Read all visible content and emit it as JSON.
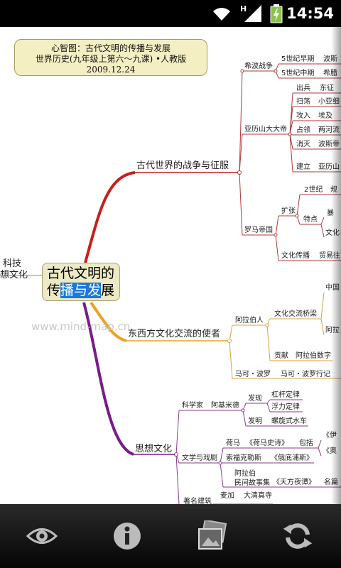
{
  "status_bar": {
    "time": "14:54",
    "icons": [
      "wifi-icon",
      "signal-h-icon",
      "battery-charging-icon"
    ],
    "network_label": "H"
  },
  "title_box": {
    "line1": "心智图：古代文明的传播与发展",
    "line2": "世界历史(九年级上第六～九课) •人教版",
    "line3": "2009.12.24"
  },
  "central": {
    "line1": "古代文明的",
    "line2": "传播与发展"
  },
  "left_cut": {
    "line1": "科技",
    "line2": "想文化"
  },
  "watermark": "www.mind-map.cn",
  "branches": {
    "war": {
      "label": "古代世界的战争与征服",
      "greek_war": {
        "label": "希波战争",
        "items": [
          {
            "label": "5世纪早期",
            "detail": "波斯"
          },
          {
            "label": "5世纪中期",
            "detail": "希腊"
          }
        ]
      },
      "alexander": {
        "label": "亚历山大大帝",
        "items": [
          {
            "label": "出兵",
            "detail": "东征"
          },
          {
            "label": "扫荡",
            "detail": "小亚细"
          },
          {
            "label": "攻入",
            "detail": "埃及"
          },
          {
            "label": "占领",
            "detail": "两河流"
          },
          {
            "label": "消灭",
            "detail": "波斯帝"
          },
          {
            "label": "建立",
            "detail": "亚历山"
          }
        ]
      },
      "rome": {
        "label": "罗马帝国",
        "expand": "扩张",
        "century": "2世纪",
        "century_detail": "规",
        "features": "特点",
        "feature_items": [
          "暴",
          "文化"
        ],
        "culture": "文化传播",
        "culture_detail": "贸易往"
      }
    },
    "envoy": {
      "label": "东西方文化交流的使者",
      "arab": {
        "label": "阿拉伯人",
        "bridge": "文化交流桥梁",
        "bridge_items": [
          "中国",
          "阿拉"
        ],
        "contribution": "贡献",
        "contribution_detail": "阿拉伯数字"
      },
      "polo": {
        "label": "马可・波罗",
        "detail": "马可・波罗行记"
      }
    },
    "thought": {
      "label": "思想文化",
      "science": {
        "label": "科学家",
        "person": "阿基米德",
        "discovery": "发现",
        "discovery_items": [
          "杠杆定律",
          "浮力定律"
        ],
        "invention": "发明",
        "invention_item": "螺旋式水车"
      },
      "literature": {
        "label": "文学与戏剧",
        "homer": "荷马",
        "homer_work": "《荷马史诗》",
        "homer_contains": "包括",
        "homer_items": [
          "《伊",
          "《奥"
        ],
        "sophocles": "索福克勒斯",
        "sophocles_work": "《俄底浦斯》",
        "arab_folk1": "阿拉伯",
        "arab_folk2": "民间故事集",
        "arabian_nights": "《天方夜谭》",
        "famous": "名篇"
      },
      "architecture": {
        "label": "著名建筑",
        "mecca": "麦加",
        "mosque": "大清真寺"
      }
    }
  },
  "bottom_bar": {
    "buttons": [
      "eye-icon",
      "info-icon",
      "gallery-icon",
      "refresh-icon"
    ]
  },
  "colors": {
    "red_branch": "#c8201c",
    "orange_branch": "#f0a020",
    "purple_branch": "#7a1a8a",
    "war_sub": "#b03a3a",
    "envoy_sub": "#e0a040",
    "thought_sub": "#8a3a8a"
  }
}
